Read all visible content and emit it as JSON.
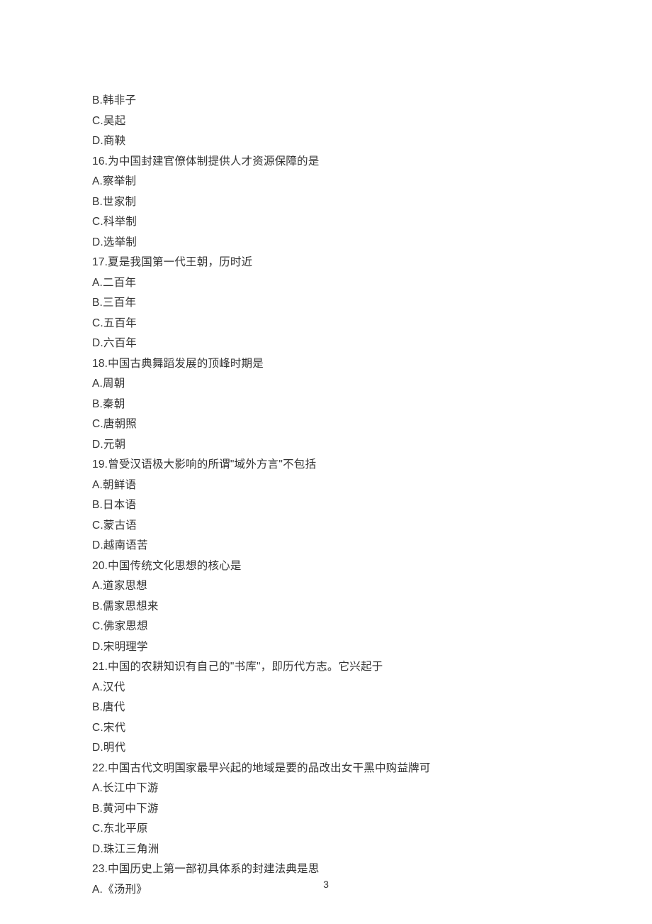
{
  "lines": [
    "B.韩非子",
    "C.吴起",
    "D.商鞅",
    "16.为中国封建官僚体制提供人才资源保障的是",
    "A.察举制",
    "B.世家制",
    "C.科举制",
    "D.选举制",
    "17.夏是我国第一代王朝，历时近",
    "A.二百年",
    "B.三百年",
    "C.五百年",
    "D.六百年",
    "18.中国古典舞蹈发展的顶峰时期是",
    "A.周朝",
    "B.秦朝",
    "C.唐朝照",
    "D.元朝",
    "19.曾受汉语极大影响的所谓\"域外方言\"不包括",
    "A.朝鲜语",
    "B.日本语",
    "C.蒙古语",
    "D.越南语苦",
    "20.中国传统文化思想的核心是",
    "A.道家思想",
    "B.儒家思想来",
    "C.佛家思想",
    "D.宋明理学",
    "21.中国的农耕知识有自己的\"书库\"，即历代方志。它兴起于",
    "A.汉代",
    "B.唐代",
    "C.宋代",
    "D.明代",
    "22.中国古代文明国家最早兴起的地域是要的品改出女干黑中购益牌可",
    "A.长江中下游",
    "B.黄河中下游",
    "C.东北平原",
    "D.珠江三角洲",
    "23.中国历史上第一部初具体系的封建法典是思",
    "A.《汤刑》"
  ],
  "page_number": "3"
}
